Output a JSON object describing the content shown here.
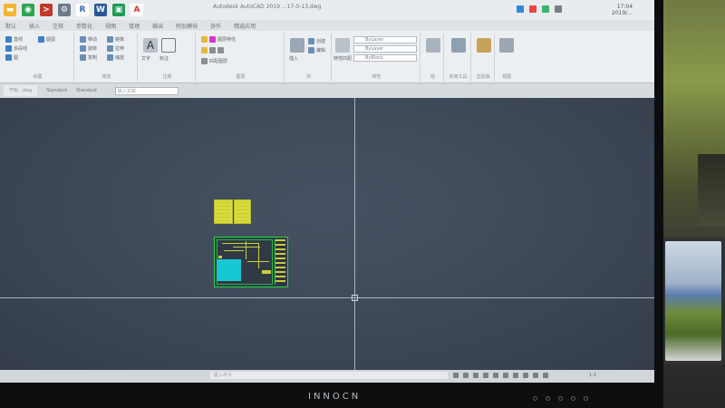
{
  "taskbar": {
    "icons": [
      {
        "name": "folder-icon",
        "color": "#f2b632",
        "glyph": "▬"
      },
      {
        "name": "browser-icon",
        "color": "#2ea44f",
        "glyph": "◉"
      },
      {
        "name": "terminal-icon",
        "color": "#c0392b",
        "glyph": ">"
      },
      {
        "name": "gear-icon",
        "color": "#6c7a89",
        "glyph": "⚙"
      },
      {
        "name": "revit-icon",
        "color": "#ffffff",
        "glyph": "R",
        "fg": "#2e6bbd"
      },
      {
        "name": "word-icon",
        "color": "#2b579a",
        "glyph": "W"
      },
      {
        "name": "app-green-icon",
        "color": "#1f9d55",
        "glyph": "▣"
      },
      {
        "name": "autocad-icon",
        "color": "#ffffff",
        "glyph": "A",
        "fg": "#d6352b"
      }
    ],
    "window_title": "Autodesk AutoCAD 2019    ...17-0-13.dwg",
    "clock_time": "17:04",
    "clock_date": "2019/..."
  },
  "ribbon": {
    "tabs": [
      "默认",
      "插入",
      "注释",
      "参数化",
      "视图",
      "管理",
      "输出",
      "附加模块",
      "协作",
      "精选应用"
    ],
    "panels": [
      {
        "label": "绘图",
        "buttons": [
          "直线",
          "多段线",
          "圆",
          "圆弧"
        ]
      },
      {
        "label": "修改",
        "buttons": [
          "移动",
          "旋转",
          "复制",
          "镜像",
          "拉伸",
          "缩放"
        ]
      },
      {
        "label": "注释",
        "buttons": [
          "文字",
          "标注"
        ]
      },
      {
        "label": "图层",
        "buttons": [
          "图层特性",
          "匹配图层"
        ]
      },
      {
        "label": "块",
        "buttons": [
          "插入",
          "创建",
          "编辑"
        ]
      },
      {
        "label": "特性",
        "buttons": [
          "特性匹配"
        ]
      },
      {
        "label": "组",
        "buttons": [
          "组"
        ]
      },
      {
        "label": "实用工具",
        "buttons": [
          "测量"
        ]
      },
      {
        "label": "剪贴板",
        "buttons": [
          "粘贴"
        ]
      },
      {
        "label": "视图",
        "buttons": [
          "基点"
        ]
      }
    ],
    "layer_values": [
      "ByLayer",
      "ByLayer",
      "ByBlock"
    ],
    "layer_color": "#e22fc9"
  },
  "docbar": {
    "tab_label": "开始...dwg",
    "style_label": "Standard",
    "style_label2": "Standard",
    "cmd_placeholder": "输入关键"
  },
  "canvas": {
    "background": "#3d4857",
    "frame_color": "#29d24a",
    "sheet_color": "#d8da3e",
    "fill_color": "#17c8d3"
  },
  "statusbar": {
    "cmd_placeholder": "键入命令",
    "scale": "1:1"
  },
  "monitor": {
    "brand": "INNOCN"
  }
}
